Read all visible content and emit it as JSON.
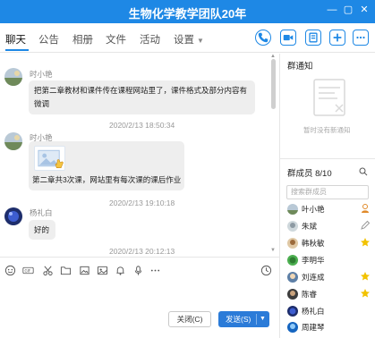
{
  "window": {
    "title": "生物化学教学团队20年",
    "controls": [
      "minimize",
      "restore",
      "close"
    ]
  },
  "tabs": [
    {
      "label": "聊天",
      "active": true
    },
    {
      "label": "公告",
      "active": false
    },
    {
      "label": "相册",
      "active": false
    },
    {
      "label": "文件",
      "active": false
    },
    {
      "label": "活动",
      "active": false
    },
    {
      "label": "设置",
      "active": false,
      "dropdown": true
    }
  ],
  "header_actions": [
    {
      "icon": "phone-icon",
      "color": "#1e88e5"
    },
    {
      "icon": "video-icon",
      "color": "#1e88e5"
    },
    {
      "icon": "screen-share-icon",
      "color": "#1e88e5"
    },
    {
      "icon": "add-icon",
      "color": "#1e88e5"
    },
    {
      "icon": "more-icon",
      "color": "#1e88e5"
    }
  ],
  "messages": [
    {
      "sender": "时小艳",
      "lines": [
        "把第二章教材和课件传在课程网站里了，课件格式及部分内容有",
        "微调"
      ]
    },
    {
      "timestamp": "2020/2/13 18:50:34"
    },
    {
      "sender": "时小艳",
      "image_icon": "image-placeholder-icon",
      "lines": [
        "第二章共3次课，网站里有每次课的课后作业"
      ]
    },
    {
      "timestamp": "2020/2/13 19:10:18"
    },
    {
      "sender": "杨礼白",
      "lines": [
        "好的"
      ]
    },
    {
      "timestamp": "2020/2/13 20:12:13"
    }
  ],
  "input_toolbar": [
    "emoji-icon",
    "gif-icon",
    "scissors-icon",
    "folder-icon",
    "image-icon",
    "picture-icon",
    "bell-icon",
    "microphone-icon",
    "more-tools-icon",
    "history-icon"
  ],
  "buttons": {
    "close": "关闭(C)",
    "send": "发送(S)"
  },
  "notice": {
    "title": "群通知",
    "empty_text": "暂时没有新通知"
  },
  "members": {
    "title": "群成员 8/10",
    "search_placeholder": "搜索群成员",
    "list": [
      {
        "name": "叶小艳",
        "tag": "owner-icon",
        "tag_color": "#e08a2a"
      },
      {
        "name": "朱斌",
        "tag": "edit-icon",
        "tag_color": "#999999"
      },
      {
        "name": "韩秋敏",
        "tag": "star-icon",
        "tag_color": "#f2c200"
      },
      {
        "name": "李明华",
        "tag": "",
        "tag_color": ""
      },
      {
        "name": "刘连成",
        "tag": "star-icon",
        "tag_color": "#f2c200"
      },
      {
        "name": "陈睿",
        "tag": "star-icon",
        "tag_color": "#f2c200"
      },
      {
        "name": "杨礼白",
        "tag": "",
        "tag_color": ""
      },
      {
        "name": "周建琴",
        "tag": "",
        "tag_color": ""
      }
    ]
  }
}
